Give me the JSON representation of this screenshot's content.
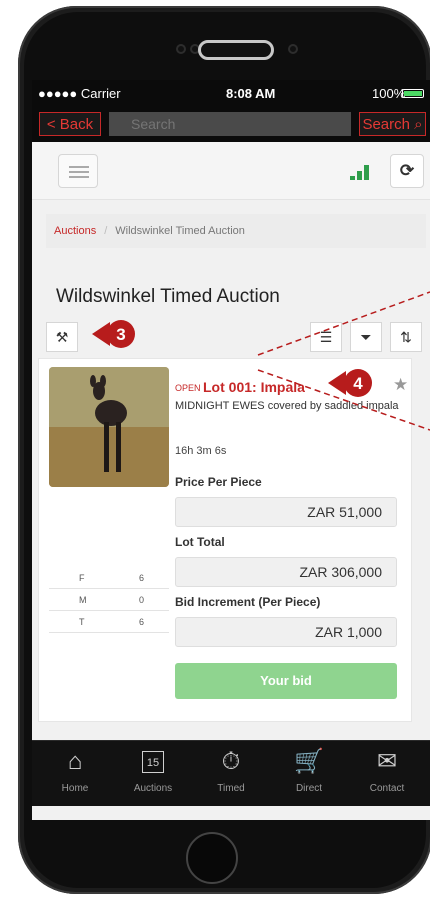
{
  "statusbar": {
    "carrier": "●●●●● Carrier",
    "time": "8:08 AM",
    "battery": "100%"
  },
  "navbar": {
    "back_label": "< Back",
    "search_placeholder": "Search",
    "search_label": "Search"
  },
  "breadcrumb": {
    "root": "Auctions",
    "separator": "/",
    "current": "Wildswinkel Timed Auction"
  },
  "page_title": "Wildswinkel Timed Auction",
  "lot": {
    "status": "OPEN",
    "title": "Lot 001: Impala",
    "description": "MIDNIGHT EWES covered by saddled impala",
    "timer": "16h 3m 6s",
    "price_label": "Price Per Piece",
    "price_value": "ZAR 51,000",
    "total_label": "Lot Total",
    "total_value": "ZAR 306,000",
    "increment_label": "Bid Increment (Per Piece)",
    "increment_value": "ZAR 1,000",
    "bid_button": "Your bid",
    "stats": [
      {
        "k": "F",
        "v": "6"
      },
      {
        "k": "M",
        "v": "0"
      },
      {
        "k": "T",
        "v": "6"
      }
    ]
  },
  "annotations": {
    "marker_3": "3",
    "marker_4": "4"
  },
  "tabbar": [
    {
      "label": "Home",
      "icon": "home-icon"
    },
    {
      "label": "Auctions",
      "icon": "calendar-icon",
      "badge": "15"
    },
    {
      "label": "Timed",
      "icon": "stopwatch-icon"
    },
    {
      "label": "Direct",
      "icon": "cart-icon"
    },
    {
      "label": "Contact",
      "icon": "envelope-icon"
    }
  ],
  "colors": {
    "accent": "#c62828",
    "signal": "#2e9e4b",
    "bid_button": "#8fd48f"
  }
}
